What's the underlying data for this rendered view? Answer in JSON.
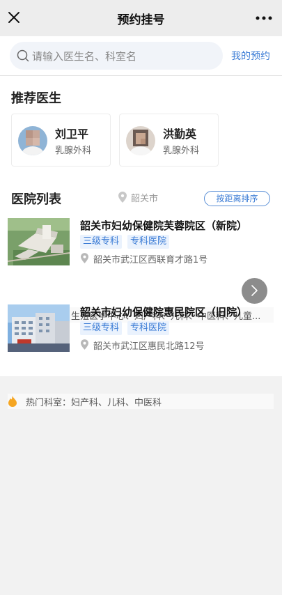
{
  "topbar": {
    "title": "预约挂号",
    "close_icon": "close-icon",
    "more_icon": "more-dots-icon"
  },
  "search": {
    "placeholder": "请输入医生名、科室名",
    "my_appointment_label": "我的预约"
  },
  "recommended": {
    "title": "推荐医生",
    "doctors": [
      {
        "name": "刘卫平",
        "department": "乳腺外科"
      },
      {
        "name": "洪勤英",
        "department": "乳腺外科"
      }
    ]
  },
  "hospitals": {
    "title": "医院列表",
    "location": "韶关市",
    "sort_label": "按距离排序",
    "items": [
      {
        "name": "韶关市妇幼保健院芙蓉院区（新院）",
        "tags": [
          "三级专科",
          "专科医院"
        ],
        "address": "韶关市武江区西联育才路1号",
        "hot_departments": "热门科室：生殖医学中心、妇产科、儿科、中医科、儿童..."
      },
      {
        "name": "韶关市妇幼保健院惠民院区（旧院）",
        "tags": [
          "三级专科",
          "专科医院"
        ],
        "address": "韶关市武江区惠民北路12号",
        "hot_departments": "热门科室：妇产科、儿科、中医科"
      }
    ]
  },
  "colors": {
    "accent": "#3a7bd5",
    "tag_bg": "#eaf2fd",
    "hot_icon": "#f5a623"
  }
}
